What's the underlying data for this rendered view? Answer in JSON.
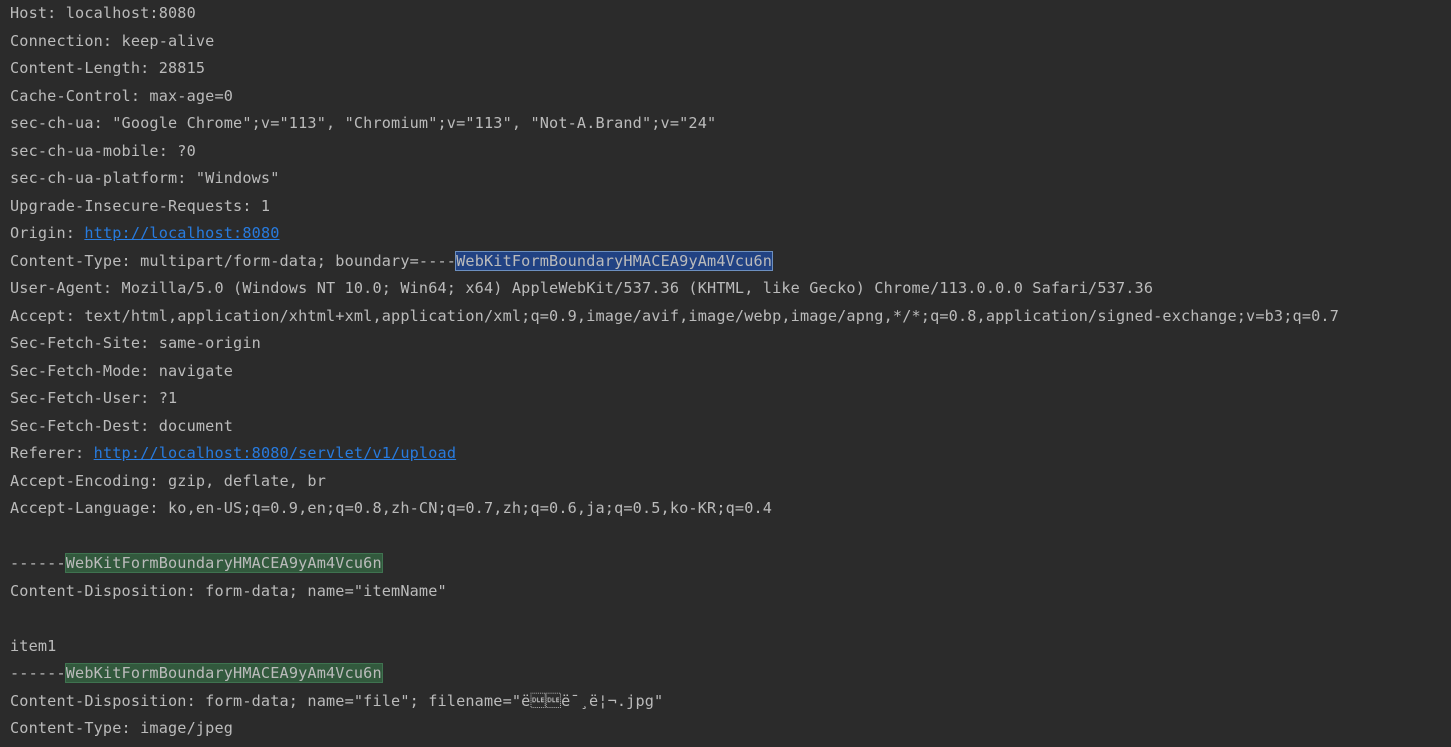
{
  "console": {
    "host": "Host: localhost:8080",
    "connection": "Connection: keep-alive",
    "content_length": "Content-Length: 28815",
    "cache_control": "Cache-Control: max-age=0",
    "sec_ch_ua": "sec-ch-ua: \"Google Chrome\";v=\"113\", \"Chromium\";v=\"113\", \"Not-A.Brand\";v=\"24\"",
    "sec_ch_ua_mobile": "sec-ch-ua-mobile: ?0",
    "sec_ch_ua_platform": "sec-ch-ua-platform: \"Windows\"",
    "upgrade_insecure": "Upgrade-Insecure-Requests: 1",
    "origin_label": "Origin: ",
    "origin_link": "http://localhost:8080",
    "content_type_prefix": "Content-Type: multipart/form-data; boundary=----",
    "content_type_boundary": "WebKitFormBoundaryHMACEA9yAm4Vcu6n",
    "user_agent": "User-Agent: Mozilla/5.0 (Windows NT 10.0; Win64; x64) AppleWebKit/537.36 (KHTML, like Gecko) Chrome/113.0.0.0 Safari/537.36",
    "accept": "Accept: text/html,application/xhtml+xml,application/xml;q=0.9,image/avif,image/webp,image/apng,*/*;q=0.8,application/signed-exchange;v=b3;q=0.7",
    "sec_fetch_site": "Sec-Fetch-Site: same-origin",
    "sec_fetch_mode": "Sec-Fetch-Mode: navigate",
    "sec_fetch_user": "Sec-Fetch-User: ?1",
    "sec_fetch_dest": "Sec-Fetch-Dest: document",
    "referer_label": "Referer: ",
    "referer_link": "http://localhost:8080/servlet/v1/upload",
    "accept_encoding": "Accept-Encoding: gzip, deflate, br",
    "accept_language": "Accept-Language: ko,en-US;q=0.9,en;q=0.8,zh-CN;q=0.7,zh;q=0.6,ja;q=0.5,ko-KR;q=0.4",
    "boundary1_prefix": "------",
    "boundary1_id": "WebKitFormBoundaryHMACEA9yAm4Vcu6n",
    "disposition_item": "Content-Disposition: form-data; name=\"itemName\"",
    "item_value": "item1",
    "boundary2_prefix": "------",
    "boundary2_id": "WebKitFormBoundaryHMACEA9yAm4Vcu6n",
    "disposition_file": "Content-Disposition: form-data; name=\"file\"; filename=\"ë\u0010\u0010ë¯¸ë¦¬.jpg\"",
    "file_content_type": "Content-Type: image/jpeg"
  },
  "colors": {
    "background": "#2b2b2b",
    "text": "#bbbbbb",
    "link": "#287bde",
    "selection": "#214283",
    "match_highlight": "#32593d"
  }
}
